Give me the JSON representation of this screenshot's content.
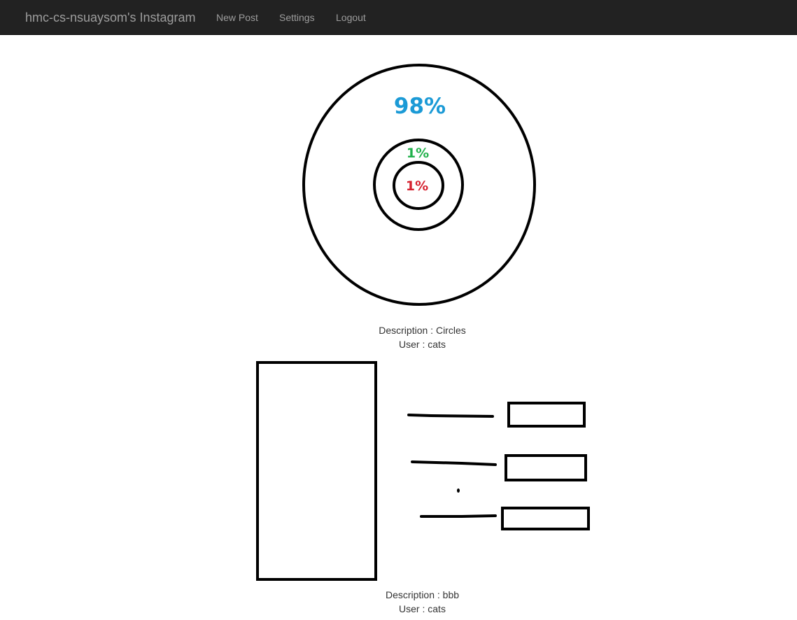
{
  "navbar": {
    "brand": "hmc-cs-nsuaysom's Instagram",
    "links": [
      "New Post",
      "Settings",
      "Logout"
    ]
  },
  "posts": [
    {
      "image_labels": {
        "outer": "98%",
        "middle": "1%",
        "inner": "1%"
      },
      "label_colors": {
        "outer": "#1b9ad6",
        "middle": "#22b14c",
        "inner": "#d5202e"
      },
      "description_label": "Description : ",
      "description": "Circles",
      "user_label": "User : ",
      "user": "cats"
    },
    {
      "description_label": "Description : ",
      "description": "bbb",
      "user_label": "User : ",
      "user": "cats"
    }
  ]
}
